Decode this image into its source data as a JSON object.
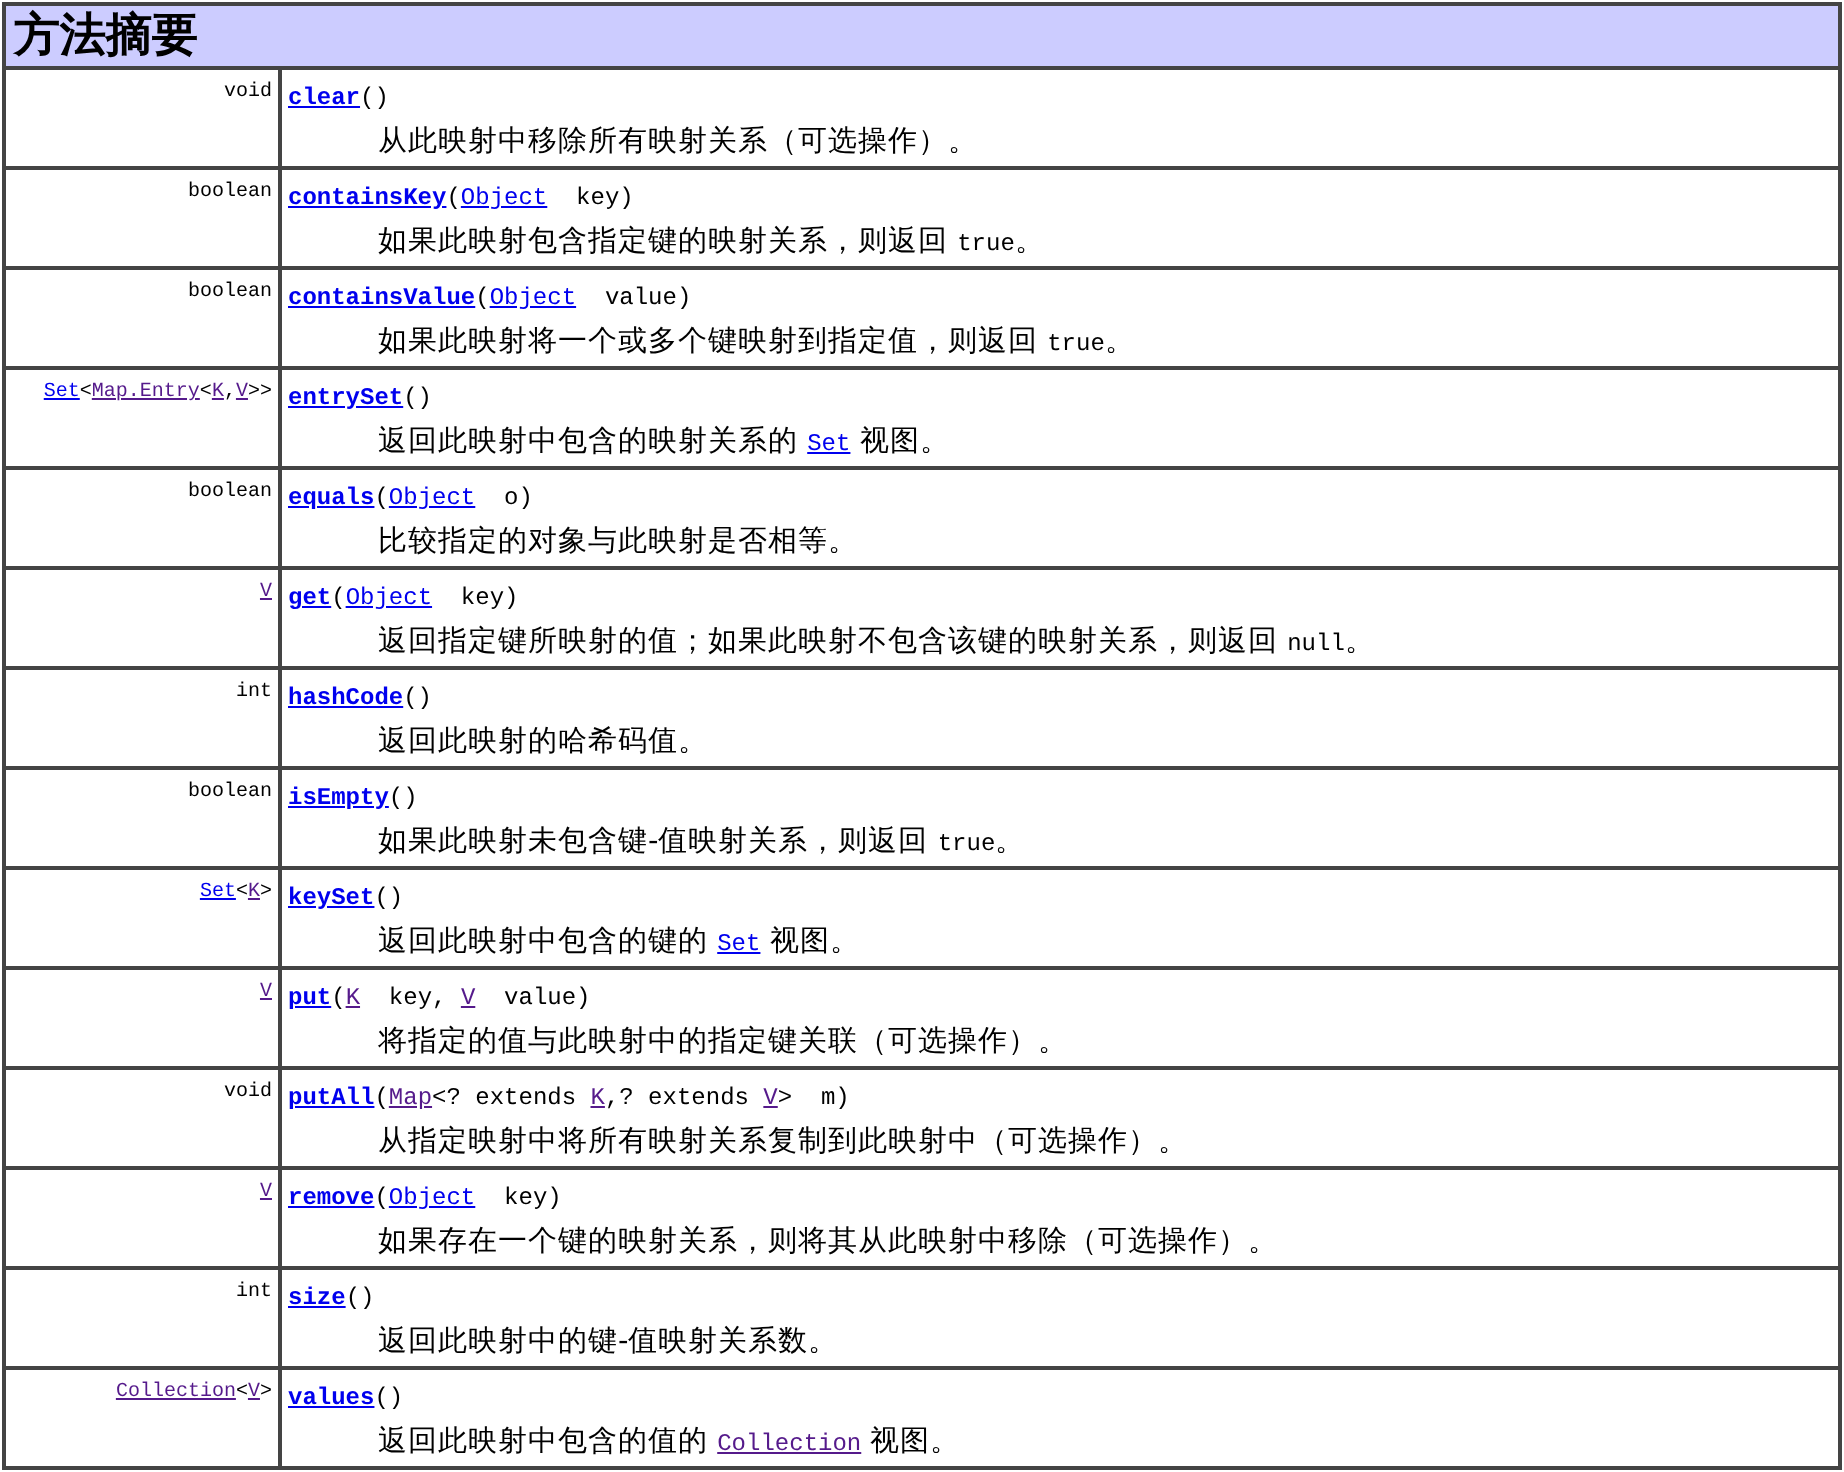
{
  "title": "方法摘要",
  "methods": [
    {
      "returns": [
        {
          "kind": "text",
          "text": "void"
        }
      ],
      "name": "clear",
      "params": [
        {
          "kind": "text",
          "text": "()"
        }
      ],
      "description": [
        {
          "kind": "text",
          "text": "从此映射中移除所有映射关系（可选操作）。"
        }
      ]
    },
    {
      "returns": [
        {
          "kind": "text",
          "text": "boolean"
        }
      ],
      "name": "containsKey",
      "params": [
        {
          "kind": "text",
          "text": "("
        },
        {
          "kind": "link",
          "text": "Object"
        },
        {
          "kind": "text",
          "text": "  key)"
        }
      ],
      "description": [
        {
          "kind": "text",
          "text": "如果此映射包含指定键的映射关系，则返回 "
        },
        {
          "kind": "code",
          "text": "true"
        },
        {
          "kind": "text",
          "text": "。"
        }
      ]
    },
    {
      "returns": [
        {
          "kind": "text",
          "text": "boolean"
        }
      ],
      "name": "containsValue",
      "params": [
        {
          "kind": "text",
          "text": "("
        },
        {
          "kind": "link",
          "text": "Object"
        },
        {
          "kind": "text",
          "text": "  value)"
        }
      ],
      "description": [
        {
          "kind": "text",
          "text": "如果此映射将一个或多个键映射到指定值，则返回 "
        },
        {
          "kind": "code",
          "text": "true"
        },
        {
          "kind": "text",
          "text": "。"
        }
      ]
    },
    {
      "returns": [
        {
          "kind": "link",
          "text": "Set"
        },
        {
          "kind": "text",
          "text": "<"
        },
        {
          "kind": "visited",
          "text": "Map.Entry"
        },
        {
          "kind": "text",
          "text": "<"
        },
        {
          "kind": "visited",
          "text": "K"
        },
        {
          "kind": "text",
          "text": ","
        },
        {
          "kind": "visited",
          "text": "V"
        },
        {
          "kind": "text",
          "text": ">>"
        }
      ],
      "name": "entrySet",
      "params": [
        {
          "kind": "text",
          "text": "()"
        }
      ],
      "description": [
        {
          "kind": "text",
          "text": "返回此映射中包含的映射关系的 "
        },
        {
          "kind": "link",
          "text": "Set"
        },
        {
          "kind": "text",
          "text": " 视图。"
        }
      ]
    },
    {
      "returns": [
        {
          "kind": "text",
          "text": "boolean"
        }
      ],
      "name": "equals",
      "params": [
        {
          "kind": "text",
          "text": "("
        },
        {
          "kind": "link",
          "text": "Object"
        },
        {
          "kind": "text",
          "text": "  o)"
        }
      ],
      "description": [
        {
          "kind": "text",
          "text": "比较指定的对象与此映射是否相等。"
        }
      ]
    },
    {
      "returns": [
        {
          "kind": "visited",
          "text": "V"
        }
      ],
      "name": "get",
      "params": [
        {
          "kind": "text",
          "text": "("
        },
        {
          "kind": "link",
          "text": "Object"
        },
        {
          "kind": "text",
          "text": "  key)"
        }
      ],
      "description": [
        {
          "kind": "text",
          "text": "返回指定键所映射的值；如果此映射不包含该键的映射关系，则返回 "
        },
        {
          "kind": "code",
          "text": "null"
        },
        {
          "kind": "text",
          "text": "。"
        }
      ]
    },
    {
      "returns": [
        {
          "kind": "text",
          "text": "int"
        }
      ],
      "name": "hashCode",
      "params": [
        {
          "kind": "text",
          "text": "()"
        }
      ],
      "description": [
        {
          "kind": "text",
          "text": "返回此映射的哈希码值。"
        }
      ]
    },
    {
      "returns": [
        {
          "kind": "text",
          "text": "boolean"
        }
      ],
      "name": "isEmpty",
      "params": [
        {
          "kind": "text",
          "text": "()"
        }
      ],
      "description": [
        {
          "kind": "text",
          "text": "如果此映射未包含键-值映射关系，则返回 "
        },
        {
          "kind": "code",
          "text": "true"
        },
        {
          "kind": "text",
          "text": "。"
        }
      ]
    },
    {
      "returns": [
        {
          "kind": "link",
          "text": "Set"
        },
        {
          "kind": "text",
          "text": "<"
        },
        {
          "kind": "visited",
          "text": "K"
        },
        {
          "kind": "text",
          "text": ">"
        }
      ],
      "name": "keySet",
      "params": [
        {
          "kind": "text",
          "text": "()"
        }
      ],
      "description": [
        {
          "kind": "text",
          "text": "返回此映射中包含的键的 "
        },
        {
          "kind": "link",
          "text": "Set"
        },
        {
          "kind": "text",
          "text": " 视图。"
        }
      ]
    },
    {
      "returns": [
        {
          "kind": "visited",
          "text": "V"
        }
      ],
      "name": "put",
      "params": [
        {
          "kind": "text",
          "text": "("
        },
        {
          "kind": "visited",
          "text": "K"
        },
        {
          "kind": "text",
          "text": "  key, "
        },
        {
          "kind": "visited",
          "text": "V"
        },
        {
          "kind": "text",
          "text": "  value)"
        }
      ],
      "description": [
        {
          "kind": "text",
          "text": "将指定的值与此映射中的指定键关联（可选操作）。"
        }
      ]
    },
    {
      "returns": [
        {
          "kind": "text",
          "text": "void"
        }
      ],
      "name": "putAll",
      "params": [
        {
          "kind": "text",
          "text": "("
        },
        {
          "kind": "visited",
          "text": "Map"
        },
        {
          "kind": "text",
          "text": "<? extends "
        },
        {
          "kind": "visited",
          "text": "K"
        },
        {
          "kind": "text",
          "text": ",? extends "
        },
        {
          "kind": "visited",
          "text": "V"
        },
        {
          "kind": "text",
          "text": ">  m)"
        }
      ],
      "description": [
        {
          "kind": "text",
          "text": "从指定映射中将所有映射关系复制到此映射中（可选操作）。"
        }
      ]
    },
    {
      "returns": [
        {
          "kind": "visited",
          "text": "V"
        }
      ],
      "name": "remove",
      "params": [
        {
          "kind": "text",
          "text": "("
        },
        {
          "kind": "link",
          "text": "Object"
        },
        {
          "kind": "text",
          "text": "  key)"
        }
      ],
      "description": [
        {
          "kind": "text",
          "text": "如果存在一个键的映射关系，则将其从此映射中移除（可选操作）。"
        }
      ]
    },
    {
      "returns": [
        {
          "kind": "text",
          "text": "int"
        }
      ],
      "name": "size",
      "params": [
        {
          "kind": "text",
          "text": "()"
        }
      ],
      "description": [
        {
          "kind": "text",
          "text": "返回此映射中的键-值映射关系数。"
        }
      ]
    },
    {
      "returns": [
        {
          "kind": "visited",
          "text": "Collection"
        },
        {
          "kind": "text",
          "text": "<"
        },
        {
          "kind": "visited",
          "text": "V"
        },
        {
          "kind": "text",
          "text": ">"
        }
      ],
      "name": "values",
      "params": [
        {
          "kind": "text",
          "text": "()"
        }
      ],
      "description": [
        {
          "kind": "text",
          "text": "返回此映射中包含的值的 "
        },
        {
          "kind": "visited",
          "text": "Collection"
        },
        {
          "kind": "text",
          "text": " 视图。"
        }
      ]
    }
  ]
}
